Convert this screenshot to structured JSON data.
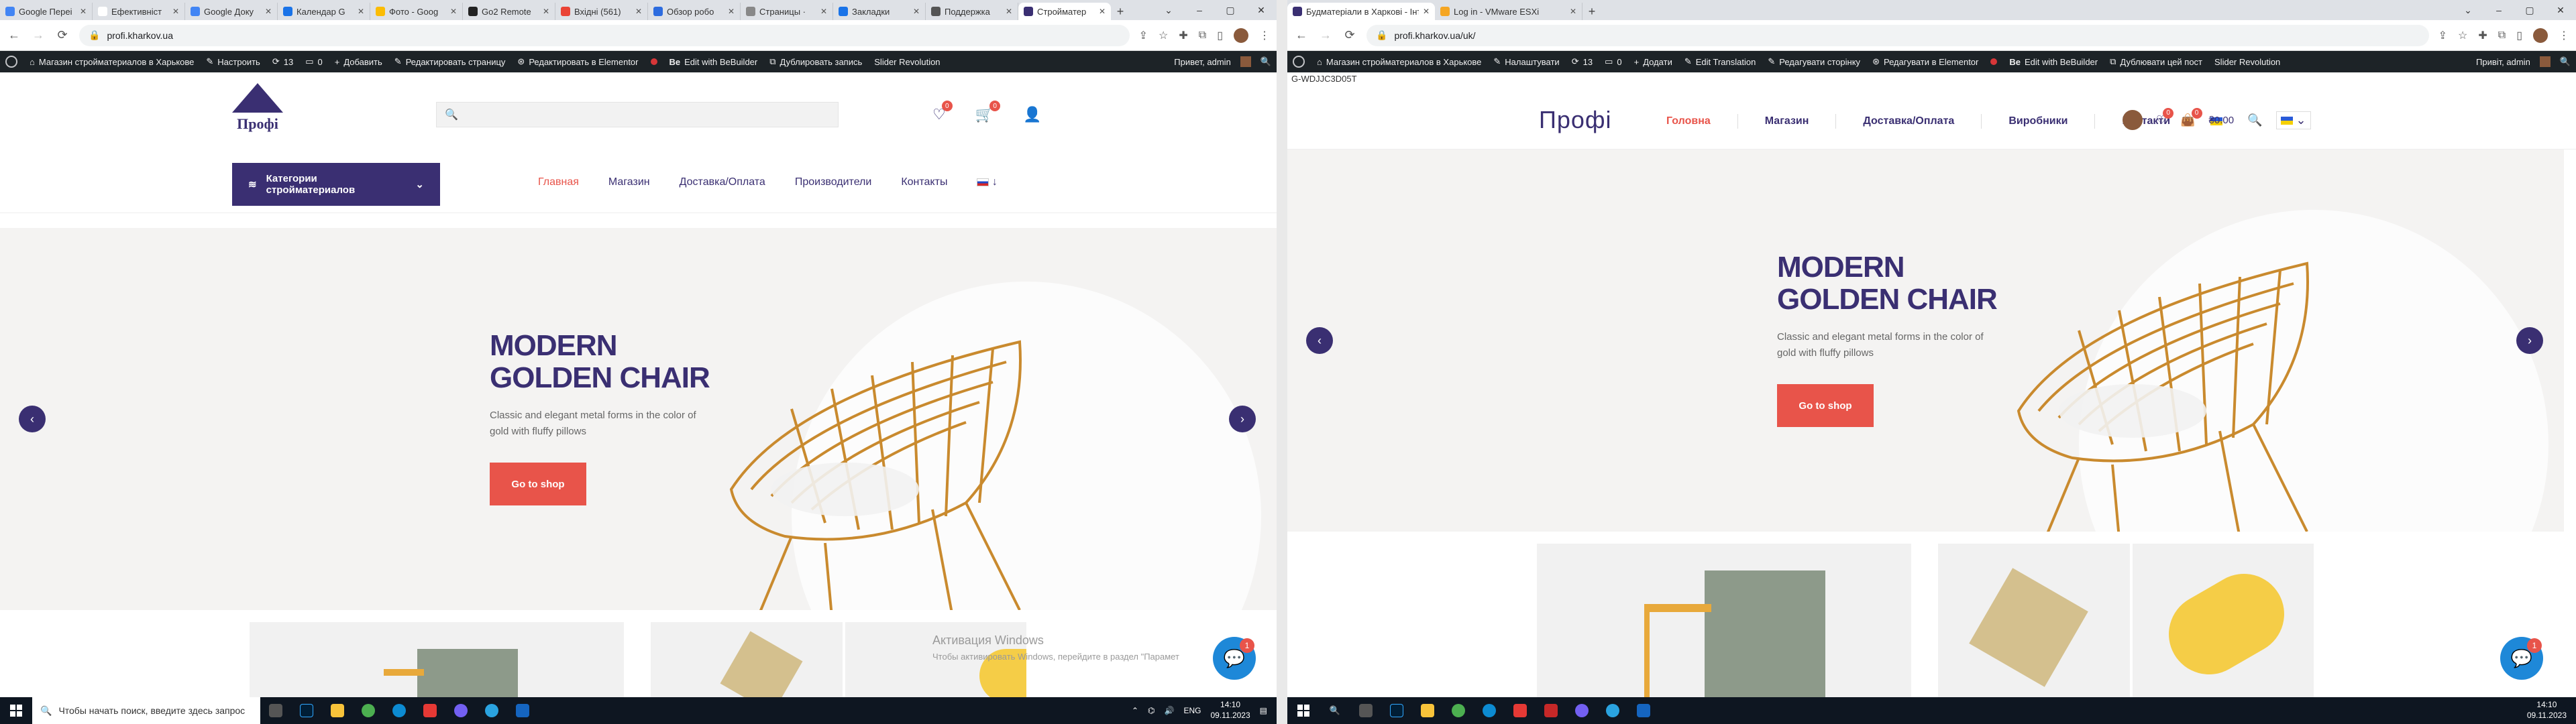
{
  "left": {
    "tabs": [
      {
        "label": "Google Переі",
        "color": "#4285f4"
      },
      {
        "label": "Ефективніст",
        "color": "#ffffff"
      },
      {
        "label": "Google Доку",
        "color": "#4285f4"
      },
      {
        "label": "Календар G",
        "color": "#1a73e8"
      },
      {
        "label": "Фото - Goog",
        "color": "#fbbc04"
      },
      {
        "label": "Go2 Remote",
        "color": "#222222"
      },
      {
        "label": "Вхідні (561)",
        "color": "#ea4335"
      },
      {
        "label": "Обзор робо",
        "color": "#2d6cdf"
      },
      {
        "label": "Страницы ·",
        "color": "#888888"
      },
      {
        "label": "Закладки",
        "color": "#1a73e8"
      },
      {
        "label": "Поддержка",
        "color": "#555555"
      },
      {
        "label": "Стройматер",
        "color": "#3a2f72"
      }
    ],
    "active_tab": 11,
    "url": "profi.kharkov.ua",
    "wpbar": {
      "items": [
        "Магазин стройматериалов в Харькове",
        "Настроить",
        "13",
        "0",
        "Добавить",
        "Редактировать страницу",
        "Редактировать в Elementor",
        "Edit with BeBuilder",
        "Дублировать запись",
        "Slider Revolution"
      ],
      "greeting": "Привет, admin"
    },
    "header": {
      "logo_text": "Профі",
      "search_placeholder": "",
      "wishlist_count": "0",
      "cart_count": "0",
      "categories_label": "Категории стройматериалов",
      "menu": [
        "Главная",
        "Магазин",
        "Доставка/Оплата",
        "Производители",
        "Контакты"
      ],
      "lang": "ru"
    },
    "hero": {
      "title_line1": "MODERN",
      "title_line2": "GOLDEN CHAIR",
      "text_line1": "Classic and elegant metal forms in the color of",
      "text_line2": "gold with fluffy pillows",
      "cta": "Go to shop"
    },
    "watermark": {
      "title": "Активация Windows",
      "text": "Чтобы активировать Windows, перейдите в раздел \"Парамет"
    },
    "chat_badge": "1",
    "taskbar": {
      "search_placeholder": "Чтобы начать поиск, введите здесь запрос",
      "lang": "ENG",
      "time": "14:10",
      "date": "09.11.2023"
    }
  },
  "right": {
    "tabs": [
      {
        "label": "Будматеріали в Харкові - Інтер",
        "color": "#3a2f72"
      },
      {
        "label": "Log in - VMware ESXi",
        "color": "#f5a623"
      }
    ],
    "active_tab": 0,
    "url": "profi.kharkov.ua/uk/",
    "wpbar": {
      "items": [
        "Магазин стройматериалов в Харькове",
        "Налаштувати",
        "13",
        "0",
        "Додати",
        "Edit Translation",
        "Редагувати сторінку",
        "Редагувати в Elementor",
        "Edit with BeBuilder",
        "Дублювати цей пост",
        "Slider Revolution"
      ],
      "greeting": "Привіт, admin"
    },
    "code": "G-WDJJC3D05T",
    "header": {
      "logo_text": "Профі",
      "menu": [
        "Головна",
        "Магазин",
        "Доставка/Оплата",
        "Виробники",
        "Контакти"
      ],
      "wishlist_count": "0",
      "cart_count": "0",
      "cart_total": "₴0.00",
      "lang": "uk"
    },
    "hero": {
      "title_line1": "MODERN",
      "title_line2": "GOLDEN CHAIR",
      "text_line1": "Classic and elegant metal forms in the color of",
      "text_line2": "gold with fluffy pillows",
      "cta": "Go to shop"
    },
    "chat_badge": "1",
    "taskbar": {
      "time": "14:10",
      "date": "09.11.2023"
    }
  },
  "colors": {
    "brand": "#3a2f72",
    "accent": "#e8544a",
    "hero_bg": "#f4f3f2",
    "chat": "#1e88d8"
  }
}
